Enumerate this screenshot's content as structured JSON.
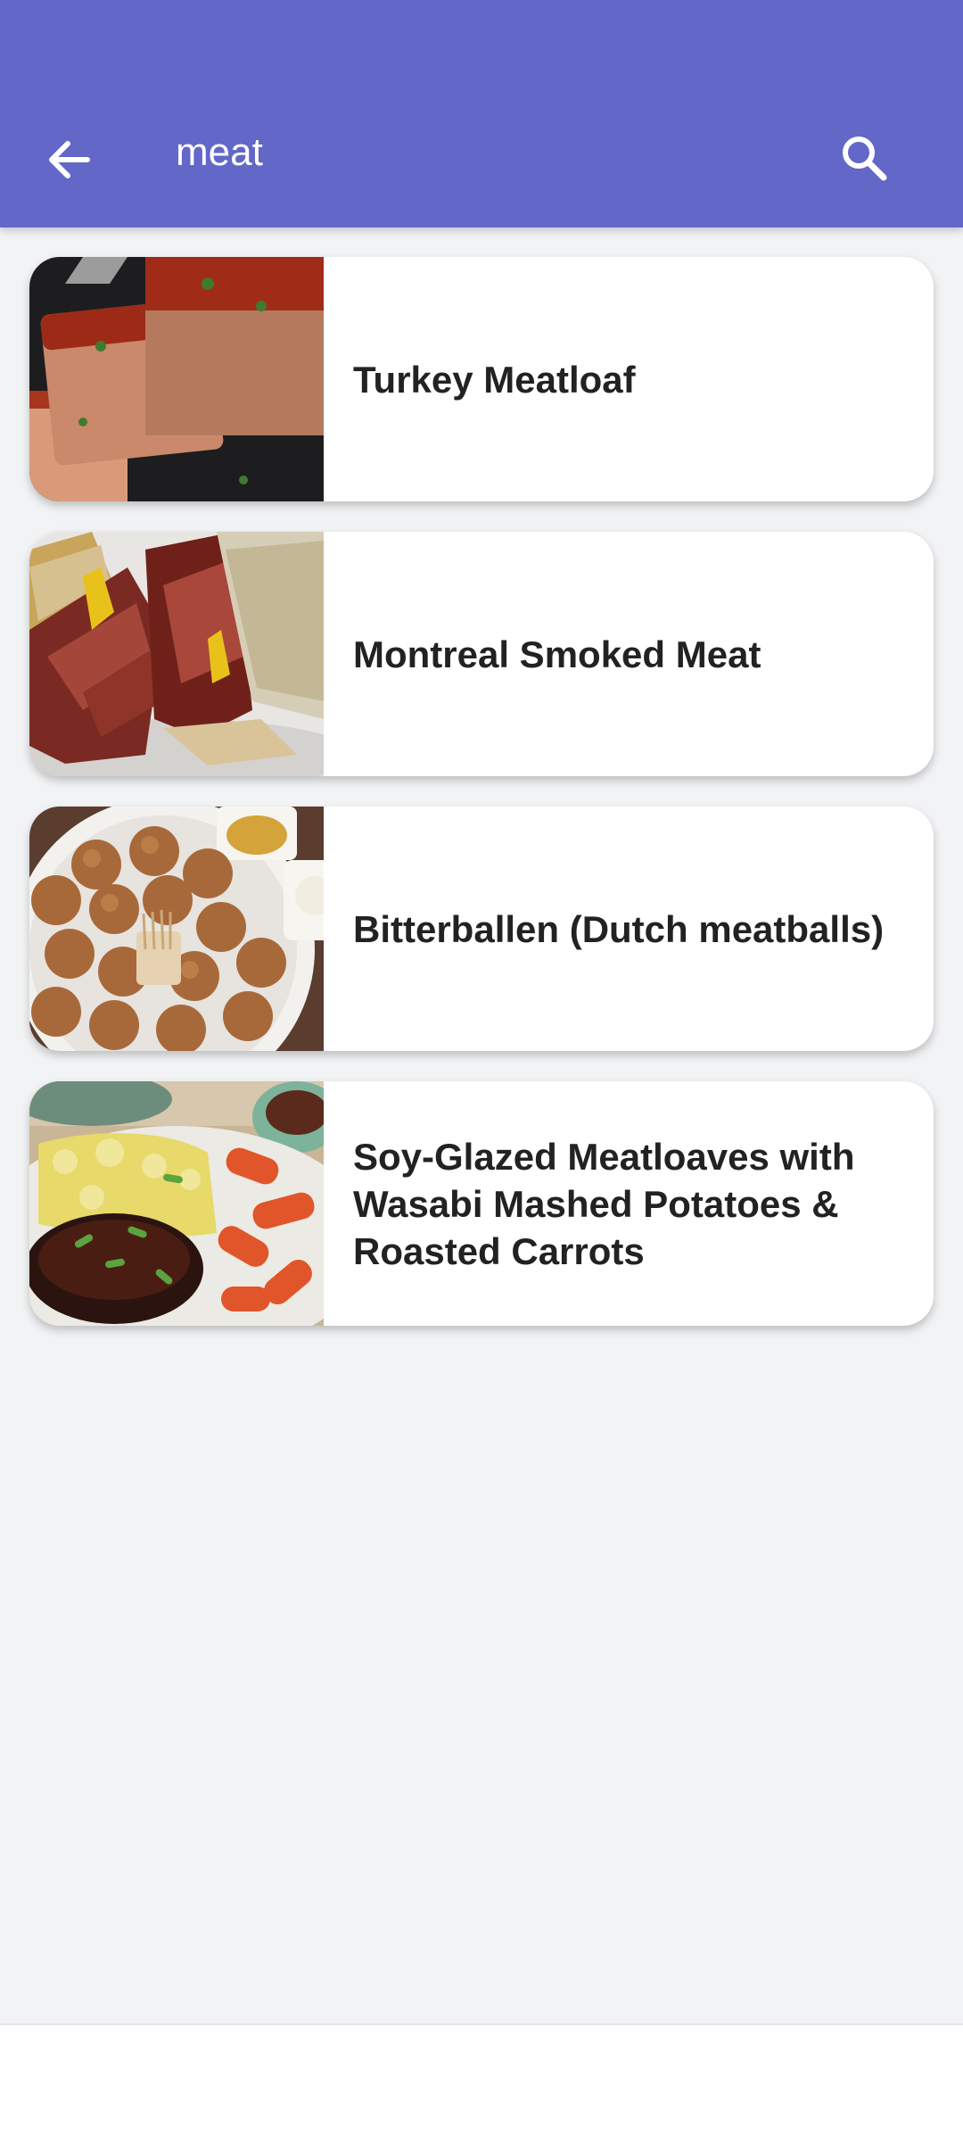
{
  "app_bar": {
    "query": "meat",
    "background": "#6267c8",
    "back_icon": "arrow-left-icon",
    "search_icon": "search-icon"
  },
  "results": [
    {
      "title": "Turkey Meatloaf",
      "image": "turkey-meatloaf-photo"
    },
    {
      "title": "Montreal Smoked Meat",
      "image": "smoked-meat-sandwich-photo"
    },
    {
      "title": "Bitterballen (Dutch meatballs)",
      "image": "bitterballen-photo"
    },
    {
      "title": "Soy-Glazed Meatloaves with Wasabi Mashed Potatoes & Roasted Carrots",
      "image": "meatloaf-mash-carrots-photo"
    }
  ]
}
